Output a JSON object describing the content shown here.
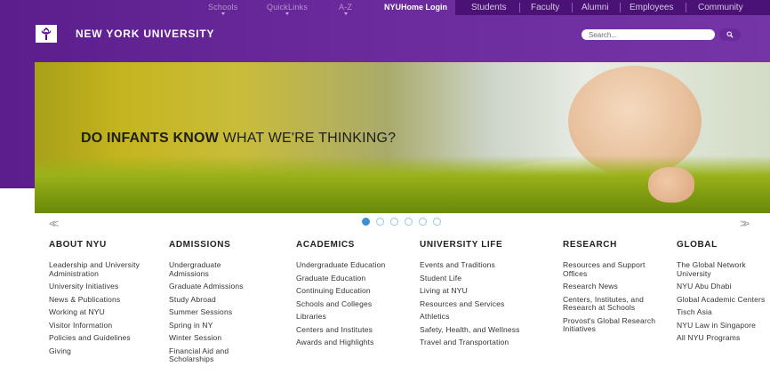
{
  "top_nav": {
    "dropdowns": [
      "Schools",
      "QuickLinks",
      "A-Z"
    ],
    "home_login": "NYUHome Login",
    "audiences": [
      "Students",
      "Faculty",
      "Alumni",
      "Employees",
      "Community"
    ]
  },
  "brand": {
    "name": "NEW YORK UNIVERSITY",
    "logo_icon": "torch-icon"
  },
  "search": {
    "placeholder": "Search...",
    "icon": "search-icon"
  },
  "hero": {
    "headline_bold": "DO INFANTS KNOW",
    "headline_rest": " WHAT WE'RE THINKING?"
  },
  "carousel": {
    "prev": "<<",
    "next": ">>",
    "slide_count": 6,
    "active_index": 0
  },
  "colors": {
    "purple": "#5c1e8c",
    "dot_active": "#3d8fd6"
  },
  "columns": [
    {
      "title": "ABOUT NYU",
      "links": [
        "Leadership and University Administration",
        "University Initiatives",
        "News & Publications",
        "Working at NYU",
        "Visitor Information",
        "Policies and Guidelines",
        "Giving"
      ]
    },
    {
      "title": "ADMISSIONS",
      "links": [
        "Undergraduate Admissions",
        "Graduate Admissions",
        "Study Abroad",
        "Summer Sessions",
        "Spring in NY",
        "Winter Session",
        "Financial Aid and Scholarships"
      ]
    },
    {
      "title": "ACADEMICS",
      "links": [
        "Undergraduate Education",
        "Graduate Education",
        "Continuing Education",
        "Schools and Colleges",
        "Libraries",
        "Centers and Institutes",
        "Awards and Highlights"
      ]
    },
    {
      "title": "UNIVERSITY LIFE",
      "links": [
        "Events and Traditions",
        "Student Life",
        "Living at NYU",
        "Resources and Services",
        "Athletics",
        "Safety, Health, and Wellness",
        "Travel and Transportation"
      ]
    },
    {
      "title": "RESEARCH",
      "links": [
        "Resources and Support Offices",
        "Research News",
        "Centers, Institutes, and Research at Schools",
        "Provost's Global Research Initiatives"
      ]
    },
    {
      "title": "GLOBAL",
      "links": [
        "The Global Network University",
        "NYU Abu Dhabi",
        "Global Academic Centers",
        "Tisch Asia",
        "NYU Law in Singapore",
        "All NYU Programs"
      ]
    }
  ]
}
